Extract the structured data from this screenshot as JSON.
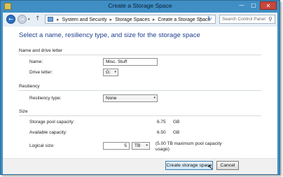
{
  "window": {
    "title": "Create a Storage Space",
    "controls": {
      "minimize": "—",
      "maximize": "□",
      "close": "✕"
    }
  },
  "navbar": {
    "back_glyph": "←",
    "forward_glyph": "→",
    "breadcrumb": [
      "System and Security",
      "Storage Spaces",
      "Create a Storage Space"
    ],
    "separator": "▸",
    "search_placeholder": "Search Control Panel"
  },
  "page": {
    "heading": "Select a name, resiliency type, and size for the storage space",
    "name_section": {
      "title": "Name and drive letter",
      "name_label": "Name:",
      "name_value": "Misc. Stuff",
      "drive_label": "Drive letter:",
      "drive_value": "G:"
    },
    "resiliency_section": {
      "title": "Resiliency",
      "type_label": "Resiliency type:",
      "type_value": "None"
    },
    "size_section": {
      "title": "Size",
      "pool_capacity_label": "Storage pool capacity:",
      "pool_capacity_value": "6.75",
      "pool_capacity_unit": "GB",
      "available_label": "Available capacity:",
      "available_value": "6.50",
      "available_unit": "GB",
      "logical_label": "Logical size:",
      "logical_value": "5",
      "logical_unit": "TB",
      "logical_note": "(5.00 TB maximum pool capacity usage)"
    }
  },
  "footer": {
    "create_label": "Create storage space",
    "cancel_label": "Cancel"
  },
  "icons": {
    "dropdown": "▾",
    "refresh": "↻",
    "search": "⚲",
    "up": "↑",
    "cursor": "↖"
  }
}
